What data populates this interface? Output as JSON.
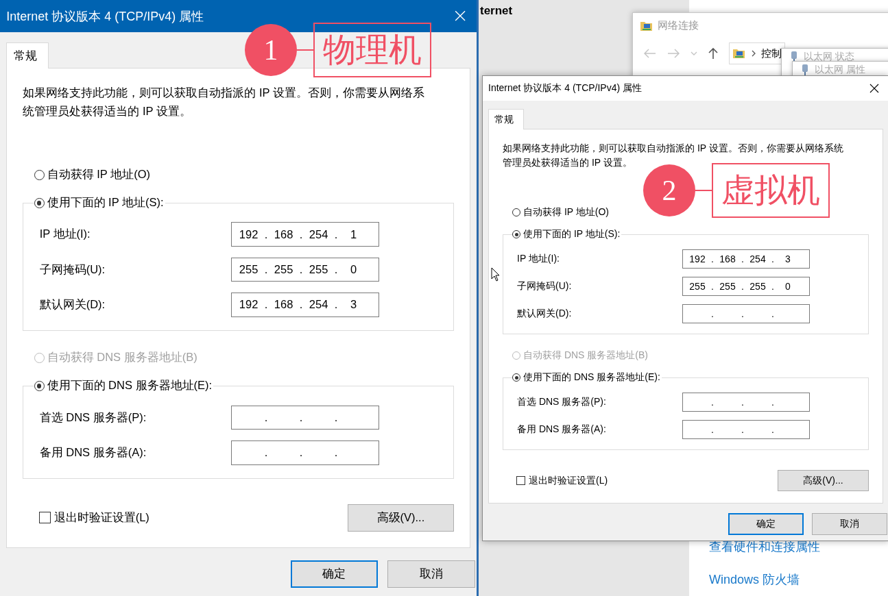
{
  "background": {
    "heading": "ternet",
    "links": [
      "查看硬件和连接属性",
      "Windows 防火墙"
    ]
  },
  "explorer": {
    "title": "网络连接",
    "breadcrumb": "控制"
  },
  "stacked_windows": [
    {
      "title": "以太网 状态"
    },
    {
      "title": "以太网 属性"
    }
  ],
  "dialogs": [
    {
      "title": "Internet 协议版本 4 (TCP/IPv4) 属性",
      "active": true,
      "tabs": [
        {
          "label": "常规",
          "selected": true
        }
      ],
      "description": "如果网络支持此功能，则可以获取自动指派的 IP 设置。否则，你需要从网络系统管理员处获得适当的 IP 设置。",
      "separator": ".",
      "ip_options": [
        {
          "label": "自动获得 IP 地址(O)",
          "selected": false,
          "disabled": false
        },
        {
          "label": "使用下面的 IP 地址(S):",
          "selected": true,
          "disabled": false
        }
      ],
      "ip_fields": [
        {
          "label": "IP 地址(I):",
          "octets": [
            "192",
            "168",
            "254",
            "1"
          ]
        },
        {
          "label": "子网掩码(U):",
          "octets": [
            "255",
            "255",
            "255",
            "0"
          ]
        },
        {
          "label": "默认网关(D):",
          "octets": [
            "192",
            "168",
            "254",
            "3"
          ]
        }
      ],
      "dns_options": [
        {
          "label": "自动获得 DNS 服务器地址(B)",
          "selected": false,
          "disabled": true
        },
        {
          "label": "使用下面的 DNS 服务器地址(E):",
          "selected": true,
          "disabled": false
        }
      ],
      "dns_fields": [
        {
          "label": "首选 DNS 服务器(P):"
        },
        {
          "label": "备用 DNS 服务器(A):"
        }
      ],
      "validate": {
        "label": "退出时验证设置(L)",
        "checked": false
      },
      "advanced_button": "高级(V)...",
      "buttons": [
        {
          "label": "确定",
          "default": true
        },
        {
          "label": "取消",
          "default": false
        }
      ]
    },
    {
      "title": "Internet 协议版本 4 (TCP/IPv4) 属性",
      "active": false,
      "tabs": [
        {
          "label": "常规",
          "selected": true
        }
      ],
      "description": "如果网络支持此功能，则可以获取自动指派的 IP 设置。否则，你需要从网络系统管理员处获得适当的 IP 设置。",
      "separator": ".",
      "ip_options": [
        {
          "label": "自动获得 IP 地址(O)",
          "selected": false,
          "disabled": false
        },
        {
          "label": "使用下面的 IP 地址(S):",
          "selected": true,
          "disabled": false
        }
      ],
      "ip_fields": [
        {
          "label": "IP 地址(I):",
          "octets": [
            "192",
            "168",
            "254",
            "3"
          ]
        },
        {
          "label": "子网掩码(U):",
          "octets": [
            "255",
            "255",
            "255",
            "0"
          ]
        },
        {
          "label": "默认网关(D):"
        }
      ],
      "dns_options": [
        {
          "label": "自动获得 DNS 服务器地址(B)",
          "selected": false,
          "disabled": true
        },
        {
          "label": "使用下面的 DNS 服务器地址(E):",
          "selected": true,
          "disabled": false
        }
      ],
      "dns_fields": [
        {
          "label": "首选 DNS 服务器(P):"
        },
        {
          "label": "备用 DNS 服务器(A):"
        }
      ],
      "validate": {
        "label": "退出时验证设置(L)",
        "checked": false
      },
      "advanced_button": "高级(V)...",
      "buttons": [
        {
          "label": "确定",
          "default": true
        },
        {
          "label": "取消",
          "default": false
        }
      ]
    }
  ],
  "annotations": [
    {
      "number": "1",
      "label": "物理机"
    },
    {
      "number": "2",
      "label": "虚拟机"
    }
  ]
}
